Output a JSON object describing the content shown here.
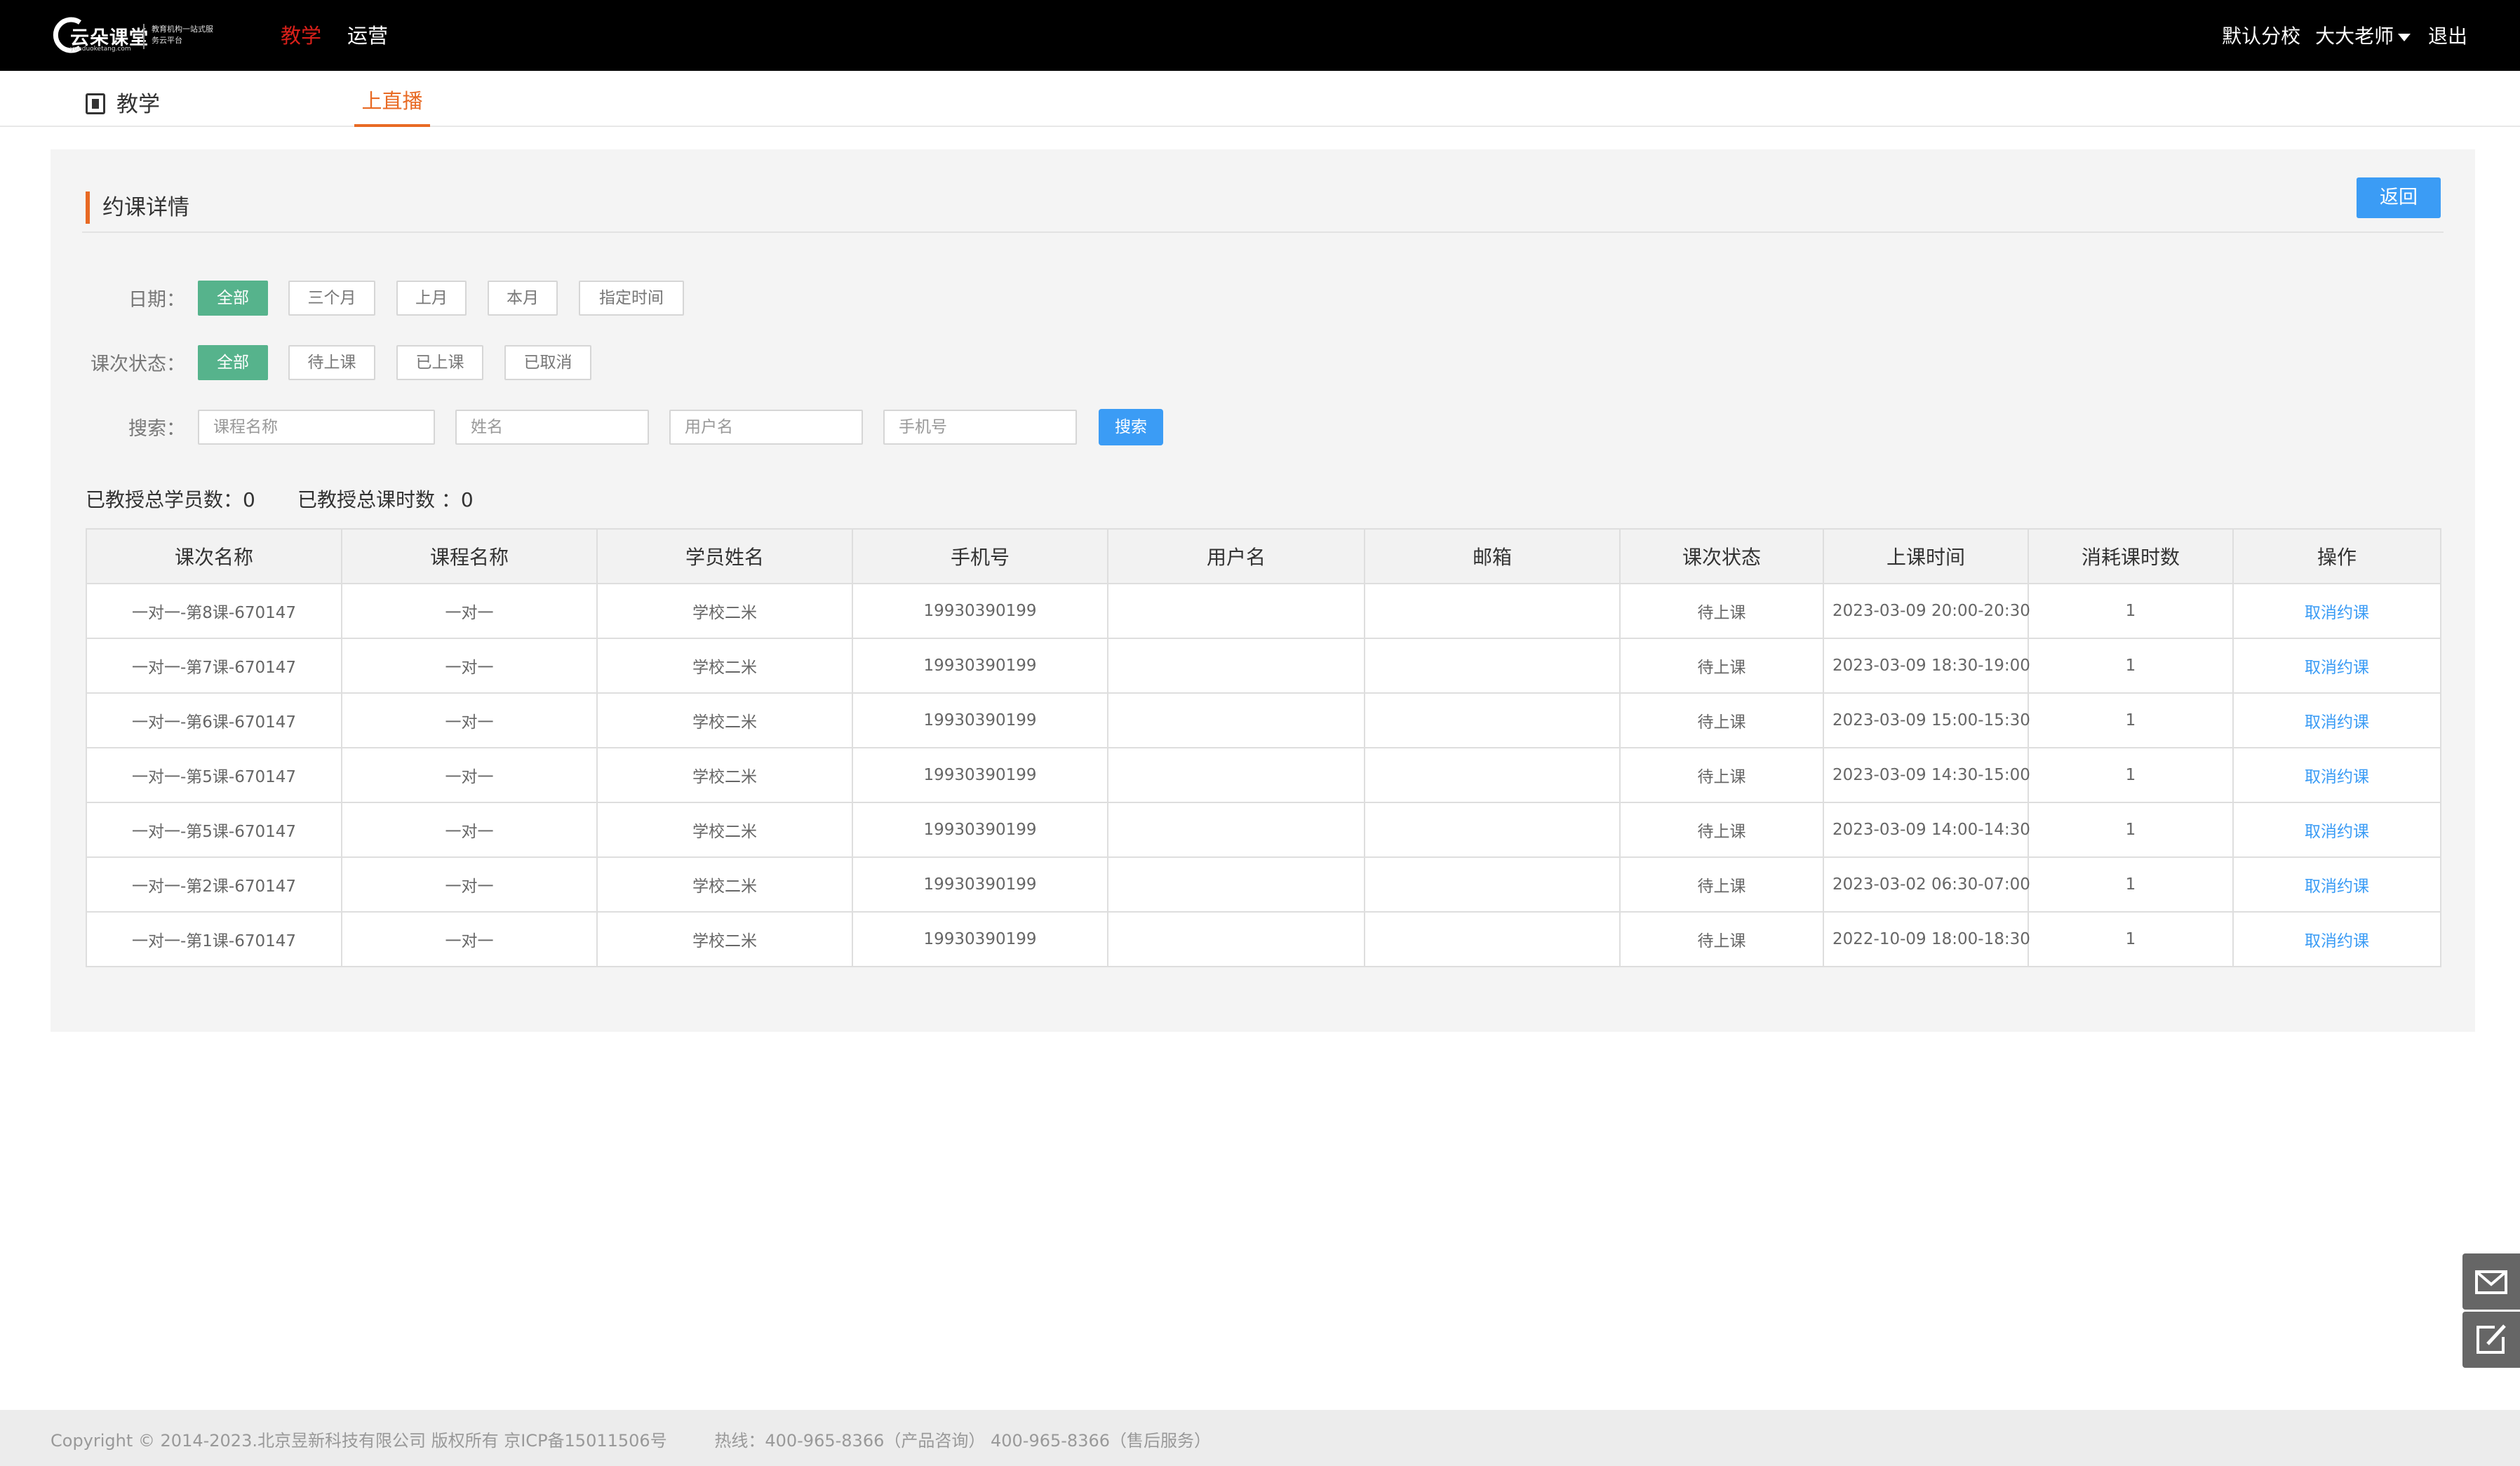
{
  "header": {
    "brand": "云朵课堂",
    "brand_sub": "yunduoketang.com",
    "slogan": "教育机构一站式服务云平台",
    "nav": [
      "教学",
      "运营"
    ],
    "branch": "默认分校",
    "user": "大大老师",
    "logout": "退出"
  },
  "subnav": {
    "section": "教学",
    "tab": "上直播"
  },
  "panel": {
    "title": "约课详情",
    "back": "返回"
  },
  "filters": {
    "date_label": "日期：",
    "date_options": [
      "全部",
      "三个月",
      "上月",
      "本月",
      "指定时间"
    ],
    "status_label": "课次状态：",
    "status_options": [
      "全部",
      "待上课",
      "已上课",
      "已取消"
    ],
    "search_label": "搜索：",
    "placeholders": [
      "课程名称",
      "姓名",
      "用户名",
      "手机号"
    ],
    "search_btn": "搜索"
  },
  "stats": {
    "students": "已教授总学员数：0",
    "hours": "已教授总课时数 ：0"
  },
  "table": {
    "headers": [
      "课次名称",
      "课程名称",
      "学员姓名",
      "手机号",
      "用户名",
      "邮箱",
      "课次状态",
      "上课时间",
      "消耗课时数",
      "操作"
    ],
    "rows": [
      [
        "一对一-第8课-670147",
        "一对一",
        "学校二米",
        "19930390199",
        "",
        "",
        "待上课",
        "2023-03-09  20:00-20:30",
        "1",
        "取消约课"
      ],
      [
        "一对一-第7课-670147",
        "一对一",
        "学校二米",
        "19930390199",
        "",
        "",
        "待上课",
        "2023-03-09  18:30-19:00",
        "1",
        "取消约课"
      ],
      [
        "一对一-第6课-670147",
        "一对一",
        "学校二米",
        "19930390199",
        "",
        "",
        "待上课",
        "2023-03-09  15:00-15:30",
        "1",
        "取消约课"
      ],
      [
        "一对一-第5课-670147",
        "一对一",
        "学校二米",
        "19930390199",
        "",
        "",
        "待上课",
        "2023-03-09  14:30-15:00",
        "1",
        "取消约课"
      ],
      [
        "一对一-第5课-670147",
        "一对一",
        "学校二米",
        "19930390199",
        "",
        "",
        "待上课",
        "2023-03-09  14:00-14:30",
        "1",
        "取消约课"
      ],
      [
        "一对一-第2课-670147",
        "一对一",
        "学校二米",
        "19930390199",
        "",
        "",
        "待上课",
        "2023-03-02  06:30-07:00",
        "1",
        "取消约课"
      ],
      [
        "一对一-第1课-670147",
        "一对一",
        "学校二米",
        "19930390199",
        "",
        "",
        "待上课",
        "2022-10-09  18:00-18:30",
        "1",
        "取消约课"
      ]
    ]
  },
  "footer": {
    "copyright": "Copyright © 2014-2023.北京昱新科技有限公司 版权所有 京ICP备15011506号",
    "hotline": "热线：400-965-8366（产品咨询） 400-965-8366（售后服务）"
  },
  "float": {
    "icons": [
      "mail-icon",
      "edit-icon"
    ]
  },
  "colors": {
    "accent": "#e86a24",
    "primary": "#3b9cf5",
    "selected_chip": "#56b38c",
    "nav_active": "#d9201a"
  }
}
